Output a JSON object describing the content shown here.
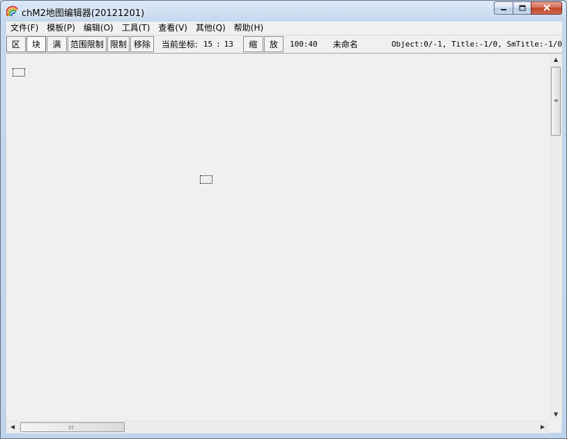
{
  "window": {
    "title": "chM2地图编辑器(20121201)",
    "icon": "rainbow-arc-icon"
  },
  "menu": [
    {
      "label": "文件(F)"
    },
    {
      "label": "模板(P)"
    },
    {
      "label": "编辑(O)"
    },
    {
      "label": "工具(T)"
    },
    {
      "label": "查看(V)"
    },
    {
      "label": "其他(Q)"
    },
    {
      "label": "帮助(H)"
    }
  ],
  "toolbar": {
    "btn_area": "区",
    "btn_block": "块",
    "btn_full": "满",
    "btn_range_limit": "范围限制",
    "btn_limit": "限制",
    "btn_remove": "移除",
    "coord_label": "当前坐标:",
    "coord_x": "15",
    "coord_sep": ":",
    "coord_y": "13",
    "btn_shrink": "缩",
    "btn_zoom": "放",
    "zoom_value": "100:40",
    "map_name": "未命名",
    "status": "Object:0/-1, Title:-1/0, SmTitle:-1/0"
  },
  "colors": {
    "canvas_bg": "#f0f0f0",
    "close_button": "#c0432a"
  }
}
